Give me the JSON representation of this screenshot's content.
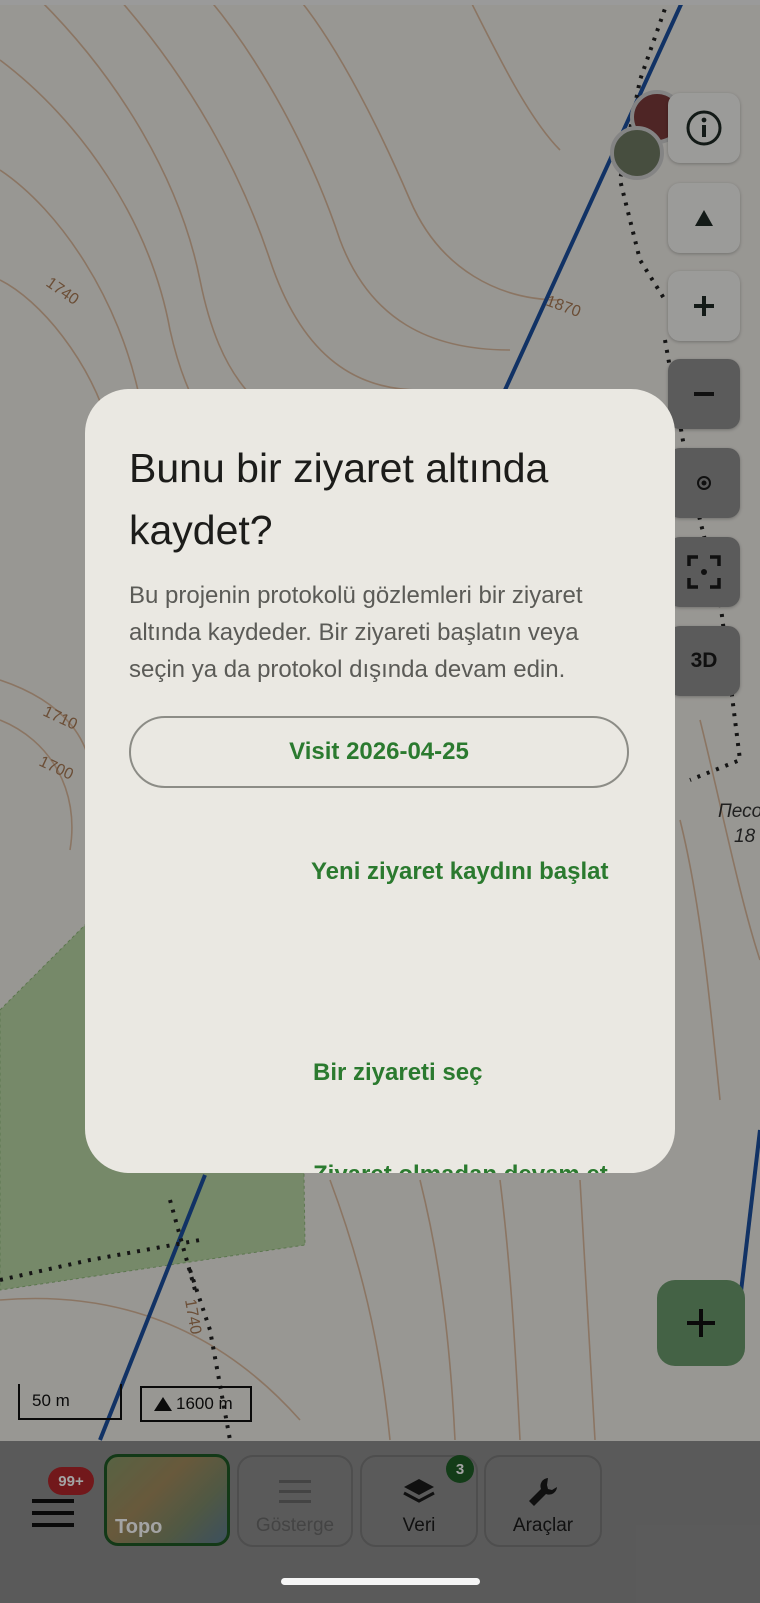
{
  "colors": {
    "accent_green": "#2b7a2f",
    "dialog_bg": "#eae8e2",
    "badge_red": "#b3262b",
    "badge_green": "#1f5e27",
    "route_blue": "#1b4f9e"
  },
  "map": {
    "contour_labels": [
      "1740",
      "1870",
      "1710",
      "1700",
      "1740"
    ],
    "place_label": [
      "Песо",
      "18"
    ]
  },
  "map_controls": {
    "info_icon": "info-icon",
    "compass_icon": "compass-icon",
    "zoom_in_icon": "zoom-in-icon",
    "zoom_out_icon": "zoom-out-icon",
    "locate_icon": "locate-icon",
    "focus_icon": "focus-frame-icon",
    "three_d_label": "3D"
  },
  "dialog": {
    "title": "Bunu bir ziyaret altında kaydet?",
    "message": "Bu projenin protokolü gözlemleri bir ziyaret altında kaydeder. Bir ziyareti başlatın veya seçin ya da protokol dışında devam edin.",
    "visit_button": "Visit 2026-04-25",
    "start_new": "Yeni ziyaret kaydını başlat",
    "choose_visit": "Bir ziyareti seç",
    "continue_without": "Ziyaret olmadan devam et"
  },
  "scale": {
    "distance": "50 m",
    "elevation": "1600 m"
  },
  "fab": {
    "icon": "plus-icon"
  },
  "bottom_nav": {
    "menu_badge": "99+",
    "topo_label": "Topo",
    "legend_label": "Gösterge",
    "data_label": "Veri",
    "data_badge": "3",
    "tools_label": "Araçlar"
  }
}
